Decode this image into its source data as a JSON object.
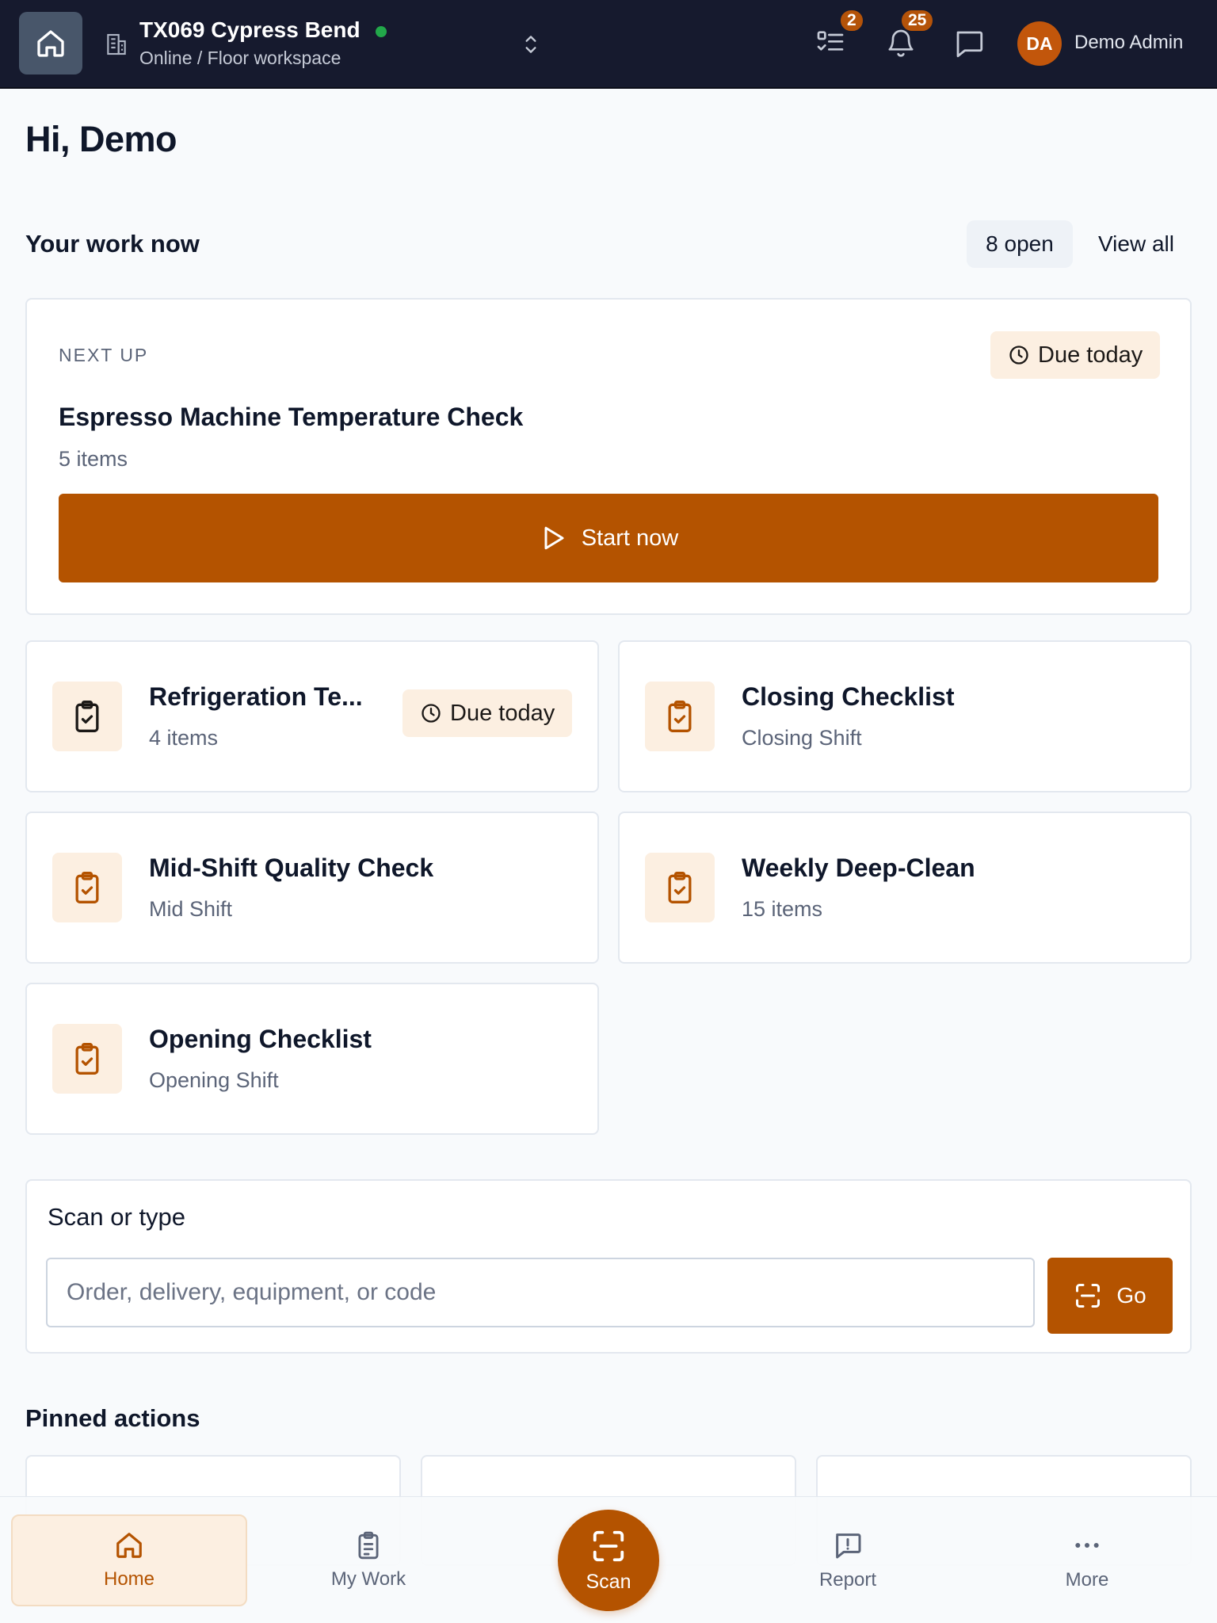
{
  "header": {
    "site_name": "TX069 Cypress Bend",
    "site_status": "Online / Floor workspace",
    "tasks_badge": "2",
    "notifications_badge": "25",
    "user_initials": "DA",
    "user_name": "Demo Admin"
  },
  "greeting": "Hi, Demo",
  "work": {
    "title": "Your work now",
    "open_count": "8 open",
    "view_all": "View all",
    "next_up": {
      "label": "NEXT UP",
      "due": "Due today",
      "title": "Espresso Machine Temperature Check",
      "subtitle": "5 items",
      "start_label": "Start now"
    },
    "tasks": [
      {
        "title": "Refrigeration Te...",
        "subtitle": "4 items",
        "due": "Due today"
      },
      {
        "title": "Closing Checklist",
        "subtitle": "Closing Shift"
      },
      {
        "title": "Mid-Shift Quality Check",
        "subtitle": "Mid Shift"
      },
      {
        "title": "Weekly Deep-Clean",
        "subtitle": "15 items"
      },
      {
        "title": "Opening Checklist",
        "subtitle": "Opening Shift"
      }
    ]
  },
  "scan": {
    "title": "Scan or type",
    "placeholder": "Order, delivery, equipment, or code",
    "go_label": "Go"
  },
  "pinned": {
    "title": "Pinned actions"
  },
  "nav": {
    "home": "Home",
    "my_work": "My Work",
    "scan": "Scan",
    "report": "Report",
    "more": "More"
  },
  "colors": {
    "accent": "#b45300",
    "accent_soft": "#fcefe1",
    "header_bg": "#161a2e",
    "online": "#22a84a"
  },
  "icons": {
    "home": "home-icon",
    "site": "building-icon",
    "switch": "chevron-up-down-icon",
    "tasks": "checklist-icon",
    "notifications": "bell-icon",
    "messages": "chat-icon",
    "due": "clock-icon",
    "start": "play-icon",
    "task": "clipboard-check-icon",
    "scan": "scan-icon",
    "report": "report-icon",
    "more": "more-dots-icon"
  }
}
